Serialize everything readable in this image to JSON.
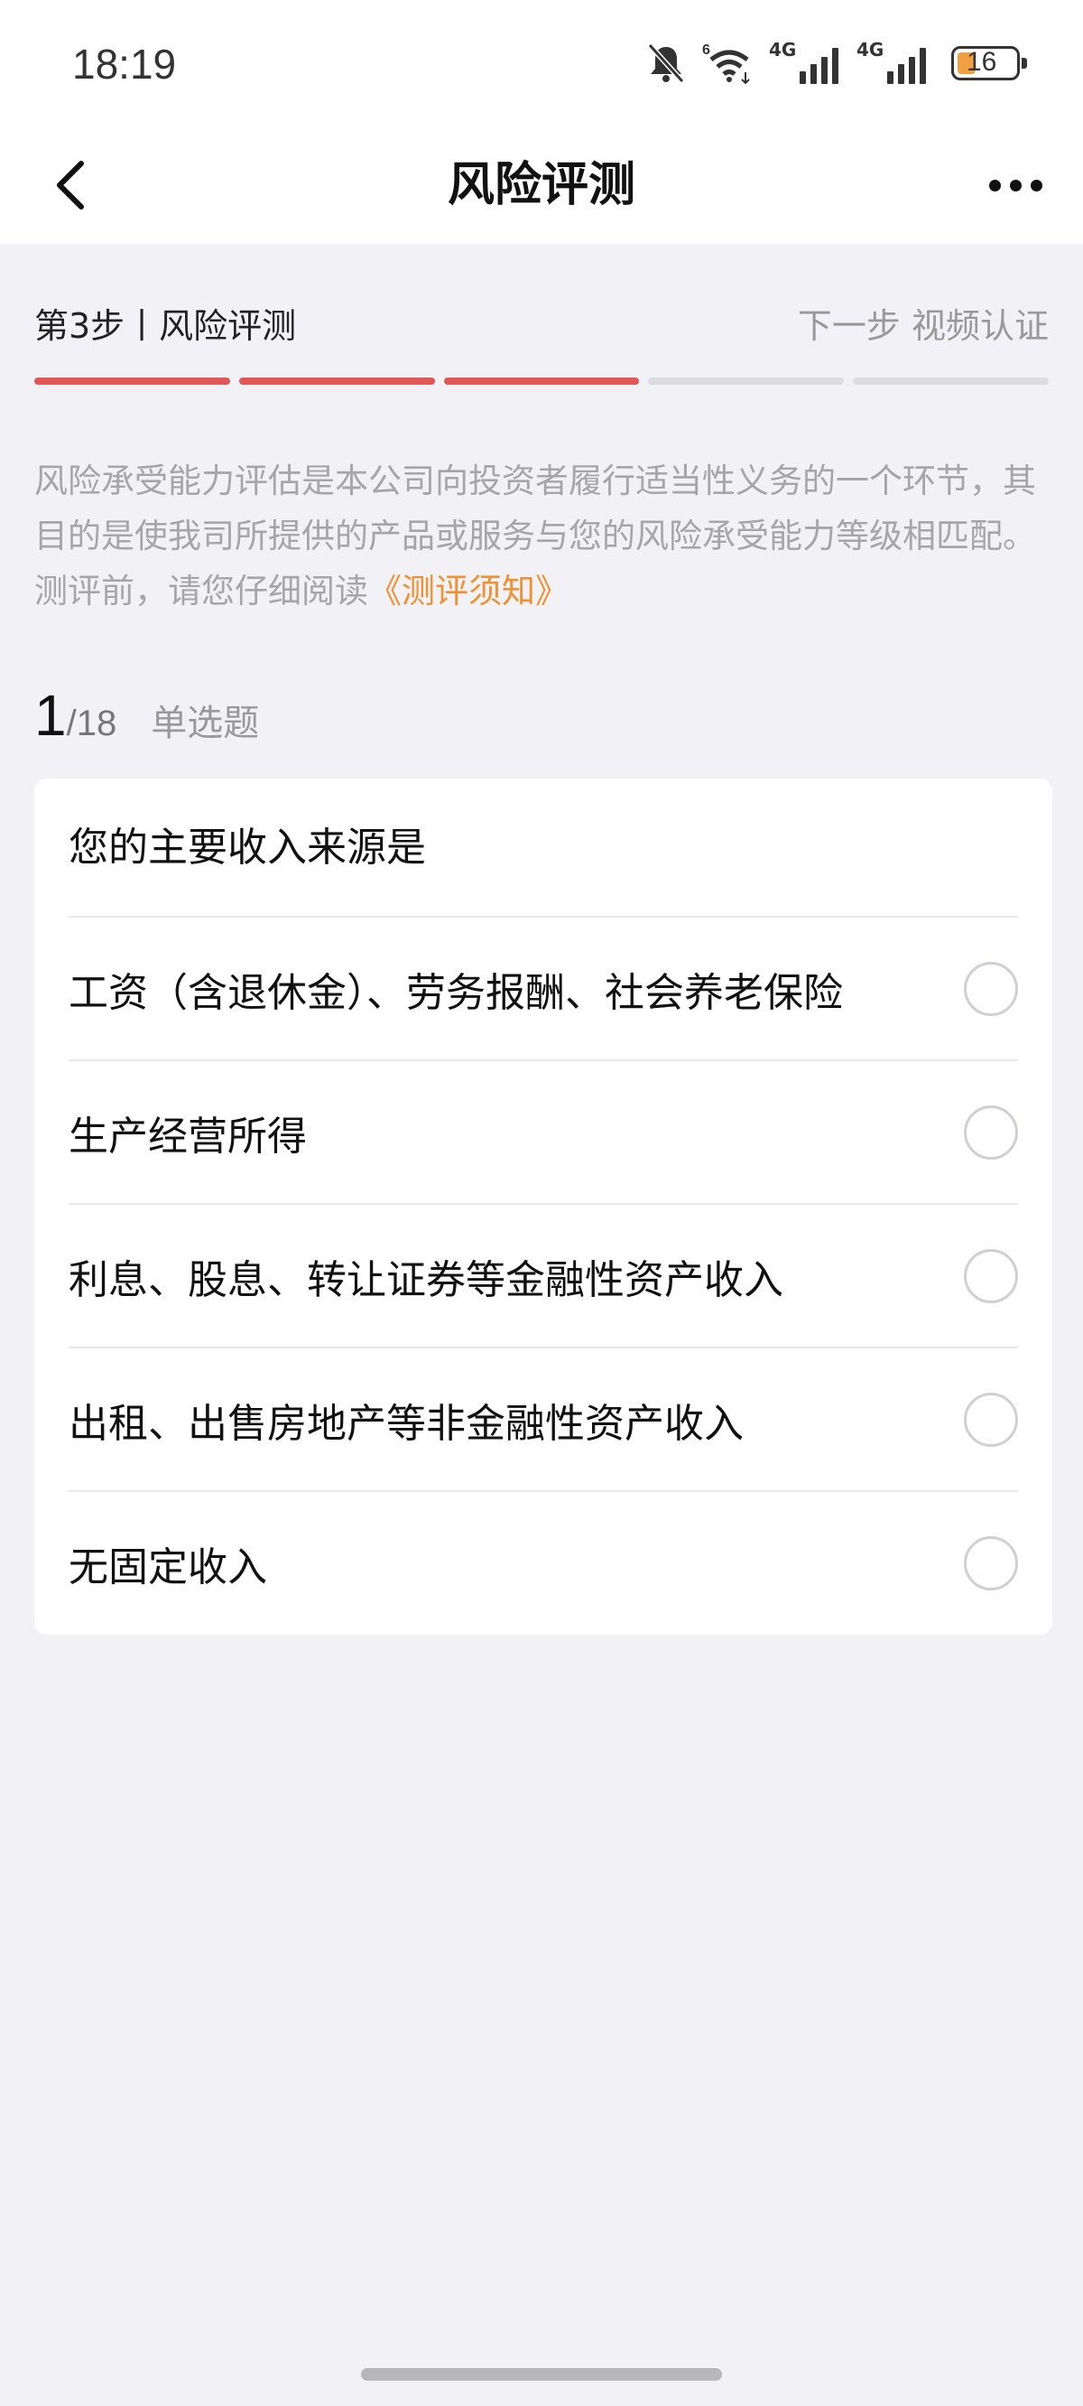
{
  "status_bar": {
    "time": "18:19",
    "network_label_1": "4G",
    "network_label_2": "4G",
    "battery_level": "16"
  },
  "header": {
    "title": "风险评测",
    "back_icon": "chevron-left-icon",
    "more_icon": "more-dots-icon"
  },
  "steps": {
    "current_label": "第3步丨风险评测",
    "next_label": "下一步 视频认证",
    "total_segments": 5,
    "completed_segments": 3,
    "active_color": "#e15757",
    "inactive_color": "#dcdce0"
  },
  "intro": {
    "text": "风险承受能力评估是本公司向投资者履行适当性义务的一个环节，其目的是使我司所提供的产品或服务与您的风险承受能力等级相匹配。测评前，请您仔细阅读",
    "link_text": "《测评须知》",
    "link_color": "#f09030"
  },
  "question": {
    "number": "1",
    "total": "/18",
    "type": "单选题",
    "title": "您的主要收入来源是",
    "options": [
      {
        "label": "工资（含退休金）、劳务报酬、社会养老保险",
        "selected": false
      },
      {
        "label": "生产经营所得",
        "selected": false
      },
      {
        "label": "利息、股息、转让证券等金融性资产收入",
        "selected": false
      },
      {
        "label": "出租、出售房地产等非金融性资产收入",
        "selected": false
      },
      {
        "label": "无固定收入",
        "selected": false
      }
    ]
  }
}
